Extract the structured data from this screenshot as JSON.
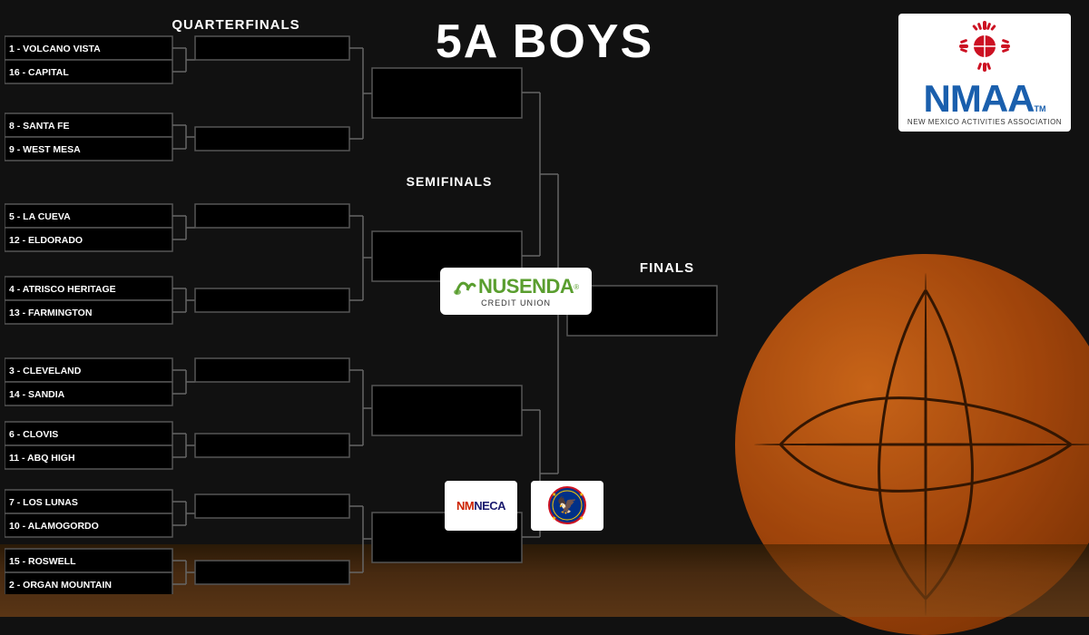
{
  "title": "5A BOYS",
  "background_color": "#111111",
  "sections": {
    "quarterfinals_label": "QUARTERFINALS",
    "semifinals_label": "SEMIFINALS",
    "finals_label": "FINALS"
  },
  "bracket": {
    "top_half": [
      {
        "id": "match1",
        "team1": "1 - VOLCANO VISTA",
        "team2": "16 - CAPITAL"
      },
      {
        "id": "match2",
        "team1": "8 - SANTA FE",
        "team2": "9 - WEST MESA"
      },
      {
        "id": "match3",
        "team1": "5 - LA CUEVA",
        "team2": "12 - ELDORADO"
      },
      {
        "id": "match4",
        "team1": "4 - ATRISCO HERITAGE",
        "team2": "13 - FARMINGTON"
      }
    ],
    "bottom_half": [
      {
        "id": "match5",
        "team1": "3 - CLEVELAND",
        "team2": "14 - SANDIA"
      },
      {
        "id": "match6",
        "team1": "6 - CLOVIS",
        "team2": "11 - ABQ HIGH"
      },
      {
        "id": "match7",
        "team1": "7 - LOS LUNAS",
        "team2": "10 - ALAMOGORDO"
      },
      {
        "id": "match8",
        "team1": "15 - ROSWELL",
        "team2": "2 - ORGAN MOUNTAIN"
      }
    ]
  },
  "sponsors": {
    "nusenda": {
      "name": "NUSENDA",
      "subtitle": "CREDIT UNION",
      "leaf_icon": "🌿"
    },
    "nmneca": {
      "name": "NMNECA"
    },
    "nm_state": {
      "name": "NEW MEXICO"
    }
  },
  "nmaa": {
    "name": "NMAA",
    "tm": "TM",
    "subtitle": "NEW MEXICO ACTIVITIES ASSOCIATION"
  },
  "colors": {
    "background": "#111111",
    "box_bg": "#000000",
    "box_border": "#555555",
    "text": "#ffffff",
    "accent_blue": "#1a5fad",
    "accent_green": "#5a9e2f",
    "basketball_orange": "#e8731a"
  }
}
